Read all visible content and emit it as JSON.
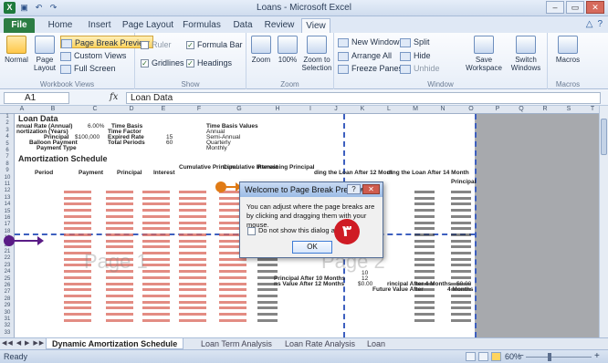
{
  "window": {
    "title": "Loans - Microsoft Excel"
  },
  "quick_access": {
    "icons": [
      "excel-logo-icon",
      "save-icon",
      "undo-icon",
      "redo-icon"
    ]
  },
  "window_controls": {
    "minimize": "–",
    "restore": "▭",
    "close": "✕"
  },
  "tabs": [
    {
      "label": "File"
    },
    {
      "label": "Home"
    },
    {
      "label": "Insert"
    },
    {
      "label": "Page Layout"
    },
    {
      "label": "Formulas"
    },
    {
      "label": "Data"
    },
    {
      "label": "Review"
    },
    {
      "label": "View"
    }
  ],
  "tab_help": {
    "help": "?",
    "min_ribbon": "△"
  },
  "ribbon": {
    "workbook_views": {
      "label": "Workbook Views",
      "normal": "Normal",
      "page_layout": "Page Layout",
      "page_break_preview": "Page Break Preview",
      "custom_views": "Custom Views",
      "full_screen": "Full Screen"
    },
    "show": {
      "label": "Show",
      "ruler": "Ruler",
      "formula_bar": "Formula Bar",
      "gridlines": "Gridlines",
      "headings": "Headings"
    },
    "zoom": {
      "label": "Zoom",
      "zoom": "Zoom",
      "zoom_100": "100%",
      "zoom_selection": "Zoom to Selection"
    },
    "window": {
      "label": "Window",
      "new_window": "New Window",
      "arrange_all": "Arrange All",
      "freeze_panes": "Freeze Panes",
      "split": "Split",
      "hide": "Hide",
      "unhide": "Unhide",
      "save_workspace": "Save Workspace",
      "switch_windows": "Switch Windows"
    },
    "macros": {
      "label": "Macros",
      "macros": "Macros"
    }
  },
  "formula_bar": {
    "name_box": "A1",
    "fx": "fx",
    "content": "Loan Data"
  },
  "sheet": {
    "columns": [
      "A",
      "B",
      "C",
      "D",
      "E",
      "F",
      "G",
      "H",
      "I",
      "J",
      "K",
      "L",
      "M",
      "N",
      "O",
      "P",
      "Q",
      "R",
      "S",
      "T"
    ],
    "rows": [
      "1",
      "2",
      "3",
      "4",
      "5",
      "6",
      "7",
      "8",
      "9",
      "10",
      "11",
      "12",
      "13",
      "14",
      "15",
      "16",
      "17",
      "18",
      "19",
      "20",
      "21",
      "22",
      "23",
      "24",
      "25",
      "26",
      "27",
      "28",
      "29",
      "30",
      "31",
      "32",
      "33"
    ],
    "loan_data_title": "Loan Data",
    "labels": {
      "interest_rate": "nnual Rate (Annual)",
      "amortization": "nortization (Years)",
      "principal": "Principal",
      "balloon": "Balloon Payment",
      "payment_type": "Payment Type",
      "rate_val": "6.00%",
      "time_basis": "Time Basis",
      "time_factor": "Time Factor",
      "expired_rate": "Expired Rate",
      "total_periods": "Total Periods",
      "principal_val": "$100,000",
      "years_val": "15",
      "periods_val": "60",
      "time_basis_values": "Time Basis Values",
      "annual": "Annual",
      "semi": "Semi-Annual",
      "quarterly": "Quarterly",
      "monthly": "Monthly"
    },
    "schedule_title": "Amortization Schedule",
    "schedule_headers": {
      "period": "Period",
      "payment": "Payment",
      "principal": "Principal",
      "interest": "Interest",
      "cum_principal": "Cumulative Principal",
      "cum_interest": "Cumulative Interest",
      "remaining": "Remaining Principal",
      "after12": "ding the Loan After 12 Mont",
      "after14": "ding the Loan After 14 Month",
      "principal_col": "Principal"
    },
    "side_notes": {
      "n1": "Principal After 10 Months",
      "n2": "ns Value After 12 Months",
      "n3": "Future Value After",
      "n4": "rincipal After 4 Months",
      "n5": "4 Months",
      "zero": "$0.00",
      "ten": "10",
      "twelve": "12"
    },
    "watermark": "Page 1",
    "watermark2": "Page 2"
  },
  "sheet_tabs": {
    "nav": "◀◀ ◀ ▶ ▶▶",
    "tabs": [
      "Dynamic Amortization Schedule",
      "Loan Term Analysis",
      "Loan Rate Analysis",
      "Loan"
    ]
  },
  "status": {
    "ready": "Ready",
    "zoom": "60%",
    "minus": "−",
    "plus": "+"
  },
  "dialog": {
    "title": "Welcome to Page Break Preview",
    "help": "?",
    "close": "✕",
    "message": "You can adjust where the page breaks are by clicking and dragging them with your mouse.",
    "checkbox": "Do not show this dialog again.",
    "ok": "OK"
  },
  "callout": {
    "step_number": "٣"
  },
  "colors": {
    "accent": "#2c7d43",
    "page_break": "#3d5fbf",
    "callout": "#cf1b24"
  }
}
